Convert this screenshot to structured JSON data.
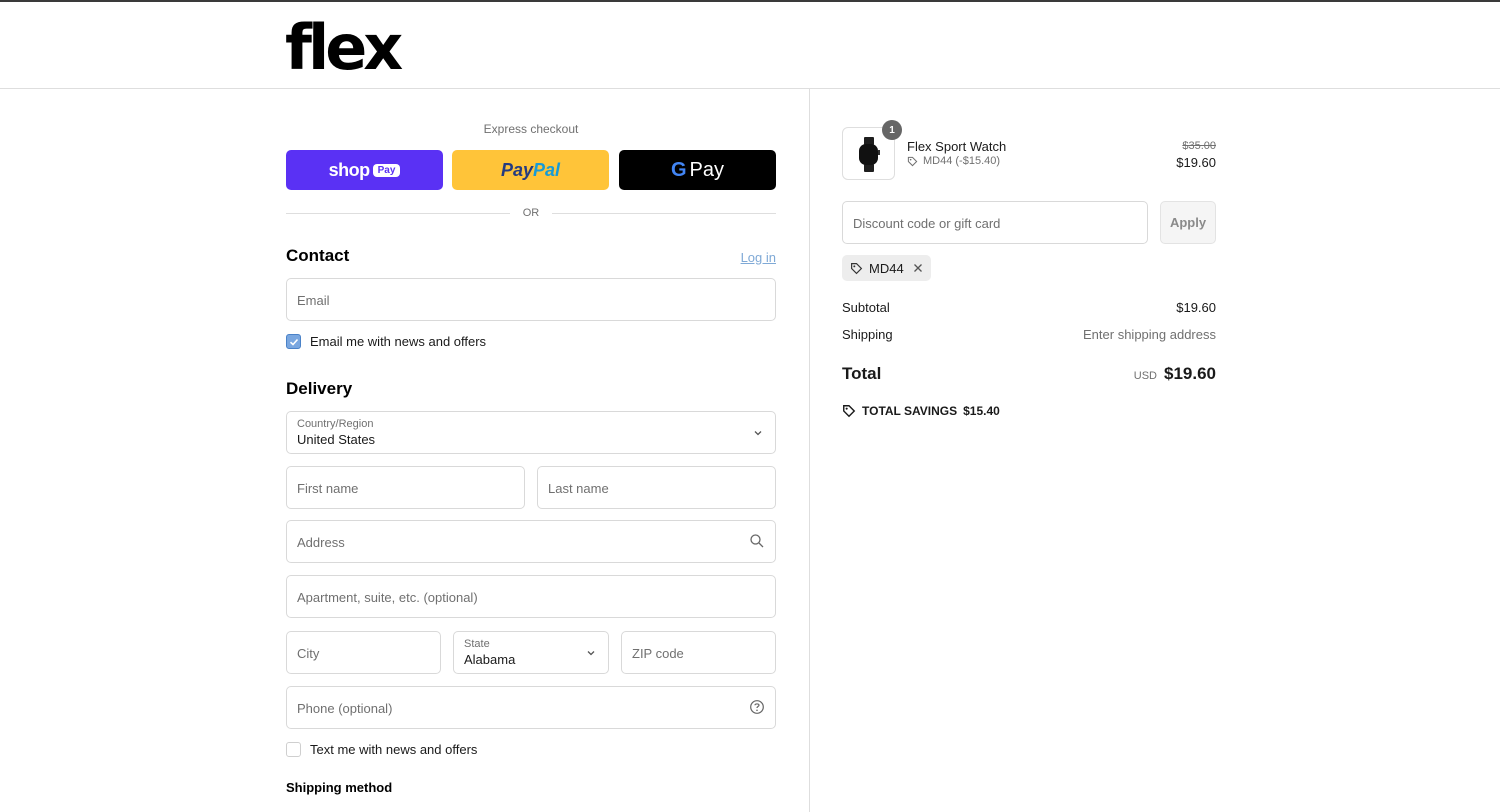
{
  "brand": {
    "logo": "flex"
  },
  "express": {
    "title": "Express checkout",
    "shop_pay": {
      "word": "shop",
      "pill": "Pay"
    },
    "paypal": {
      "part1": "Pay",
      "part2": "Pal"
    },
    "gpay": {
      "g": "G",
      "pay": "Pay"
    },
    "or": "OR"
  },
  "contact": {
    "title": "Contact",
    "login": "Log in",
    "email_placeholder": "Email",
    "newsletter_label": "Email me with news and offers",
    "newsletter_checked": true
  },
  "delivery": {
    "title": "Delivery",
    "country_label": "Country/Region",
    "country_value": "United States",
    "first_name_placeholder": "First name",
    "last_name_placeholder": "Last name",
    "address_placeholder": "Address",
    "apartment_placeholder": "Apartment, suite, etc. (optional)",
    "city_placeholder": "City",
    "state_label": "State",
    "state_value": "Alabama",
    "zip_placeholder": "ZIP code",
    "phone_placeholder": "Phone (optional)",
    "sms_label": "Text me with news and offers",
    "sms_checked": false
  },
  "shipping_method": {
    "title": "Shipping method"
  },
  "order": {
    "item": {
      "name": "Flex Sport Watch",
      "quantity": "1",
      "discount": "MD44 (-$15.40)",
      "original_price": "$35.00",
      "price": "$19.60"
    },
    "discount_placeholder": "Discount code or gift card",
    "apply_label": "Apply",
    "applied_code": "MD44",
    "subtotal_label": "Subtotal",
    "subtotal_value": "$19.60",
    "shipping_label": "Shipping",
    "shipping_value": "Enter shipping address",
    "total_label": "Total",
    "currency": "USD",
    "total_value": "$19.60",
    "savings_label": "TOTAL SAVINGS",
    "savings_value": "$15.40"
  },
  "colors": {
    "shop_pay": "#5a31f4",
    "paypal": "#ffc439",
    "gpay": "#000000",
    "checkbox_checked": "#7aa7e0",
    "link": "#7fa9d6"
  }
}
